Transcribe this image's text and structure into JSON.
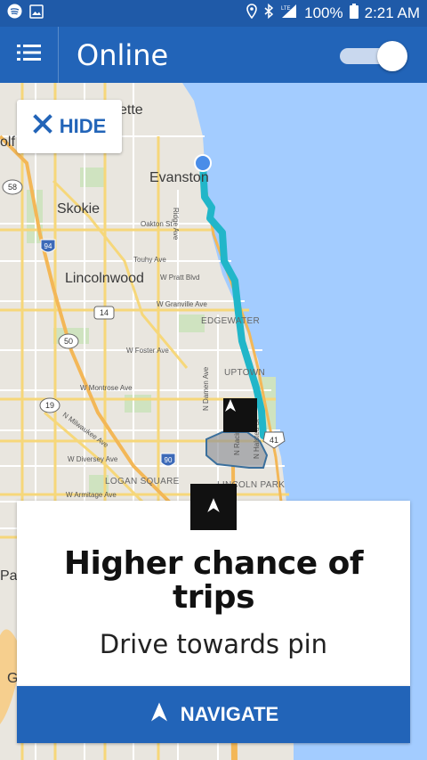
{
  "status_bar": {
    "battery": "100%",
    "time": "2:21 AM",
    "network": "LTE",
    "icons": [
      "spotify-icon",
      "image-icon",
      "location-icon",
      "bluetooth-icon",
      "signal-icon",
      "battery-icon"
    ]
  },
  "app_bar": {
    "title": "Online",
    "toggle_on": true,
    "menu_icon": "menu-icon"
  },
  "map": {
    "cities": [
      "Evanston",
      "Skokie",
      "Lincolnwood"
    ],
    "streets": [
      "Oakton St",
      "Touhy Ave",
      "W Pratt Blvd",
      "W Granville Ave",
      "W Foster Ave",
      "W Montrose Ave",
      "N Milwaukee Ave",
      "W Diversey Ave",
      "W Armitage Ave",
      "Ridge Ave",
      "N Damen Ave",
      "N Racine Ave",
      "N Halsted St"
    ],
    "neighborhoods": [
      "EDGEWATER",
      "UPTOWN",
      "LOGAN SQUARE",
      "LINCOLN PARK"
    ],
    "route_shields": [
      "58",
      "94",
      "14",
      "50",
      "19",
      "90",
      "41"
    ],
    "edge_fragments": [
      "olf",
      "ette",
      "Pa",
      "G"
    ],
    "route_color": "#21b6c9",
    "water_color": "#a3ccff"
  },
  "hide_button": {
    "label": "HIDE",
    "icon": "close-icon"
  },
  "card": {
    "title_line1": "Higher chance of",
    "title_line2": "trips",
    "subtitle": "Drive towards pin"
  },
  "navigate_button": {
    "label": "NAVIGATE",
    "icon": "navigation-arrow-icon"
  },
  "colors": {
    "primary": "#2264b8",
    "status_bar": "#1f5aa8"
  }
}
